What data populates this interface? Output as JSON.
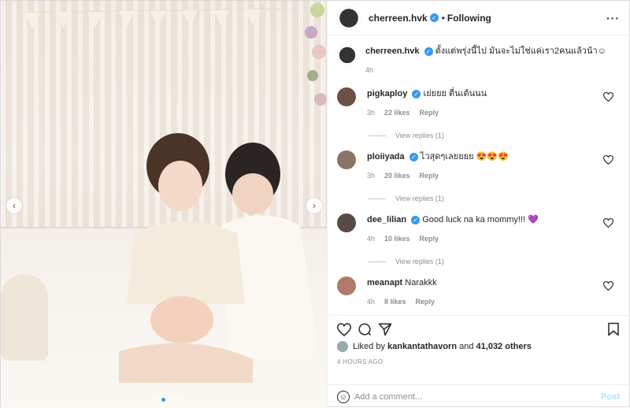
{
  "post": {
    "author": "cherreen.hvk",
    "follow_status": "Following",
    "caption": "ตั้งแต่พรุ่งนี้ไป มันจะไม่ใช่แค่เรา2คนแล้วน้า☺",
    "caption_time": "4h"
  },
  "comments": [
    {
      "user": "pigkaploy",
      "text": "เย่ยยย ตื่นเต้นนน",
      "time": "3h",
      "likes": "22 likes",
      "reply": "Reply",
      "view_replies": "View replies (1)",
      "avatar_color": "#6b5146"
    },
    {
      "user": "ploiiyada",
      "text": "ไวสุดๆเลยยยย 😍😍😍",
      "time": "3h",
      "likes": "20 likes",
      "reply": "Reply",
      "view_replies": "View replies (1)",
      "avatar_color": "#8a7466"
    },
    {
      "user": "dee_lilian",
      "text": "Good luck na ka mommy!!! 💜",
      "time": "4h",
      "likes": "10 likes",
      "reply": "Reply",
      "view_replies": "View replies (1)",
      "avatar_color": "#5a4a44"
    },
    {
      "user": "meanapt",
      "text": "Narakkk",
      "time": "4h",
      "likes": "8 likes",
      "reply": "Reply",
      "view_replies": "",
      "avatar_color": "#b07a6a"
    }
  ],
  "likes": {
    "prefix": "Liked by",
    "user": "kankantathavorn",
    "joiner": "and",
    "others": "41,032 others"
  },
  "posted_ago": "4 HOURS AGO",
  "add_comment": {
    "placeholder": "Add a comment...",
    "post_label": "Post"
  },
  "icons": [
    "heart-icon",
    "comment-icon",
    "share-icon",
    "bookmark-icon",
    "smile-icon",
    "more-icon",
    "verified-icon"
  ],
  "colors": {
    "verified": "#3897f0",
    "muted": "#8e8e8e",
    "post_disabled": "#b2dffc"
  }
}
